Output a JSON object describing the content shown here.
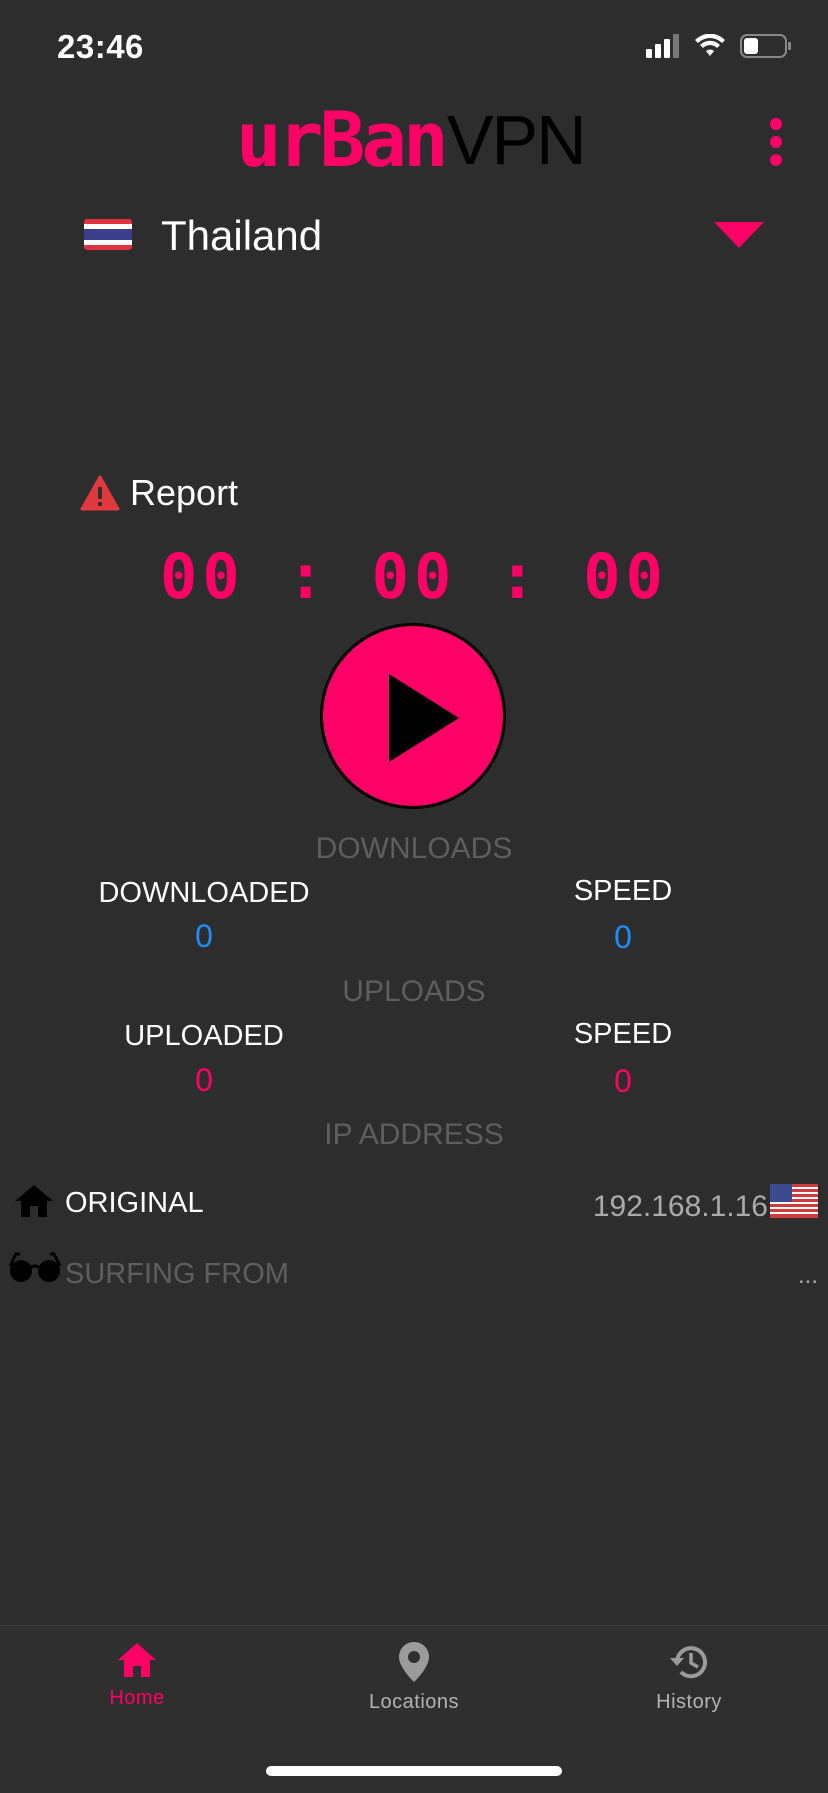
{
  "status_bar": {
    "time": "23:46"
  },
  "header": {
    "logo_urban": "urBan",
    "logo_vpn": "VPN"
  },
  "colors": {
    "accent": "#ff0066",
    "background": "#2d2d2d",
    "value_blue": "#1e8cff",
    "muted": "#5e5e5e"
  },
  "country": {
    "name": "Thailand"
  },
  "report": {
    "label": "Report"
  },
  "timer": {
    "value": "00 : 00 : 00"
  },
  "stats": {
    "downloads_heading": "DOWNLOADS",
    "downloaded_label": "DOWNLOADED",
    "downloaded_value": "0",
    "download_speed_label": "SPEED",
    "download_speed_value": "0",
    "uploads_heading": "UPLOADS",
    "uploaded_label": "UPLOADED",
    "uploaded_value": "0",
    "upload_speed_label": "SPEED",
    "upload_speed_value": "0"
  },
  "ip": {
    "heading": "IP ADDRESS",
    "original_label": "ORIGINAL",
    "original_value": "192.168.1.16",
    "surfing_label": "SURFING FROM",
    "surfing_value": "..."
  },
  "nav": {
    "items": [
      {
        "label": "Home",
        "icon": "home-icon",
        "active": true
      },
      {
        "label": "Locations",
        "icon": "location-pin-icon",
        "active": false
      },
      {
        "label": "History",
        "icon": "history-icon",
        "active": false
      }
    ]
  }
}
